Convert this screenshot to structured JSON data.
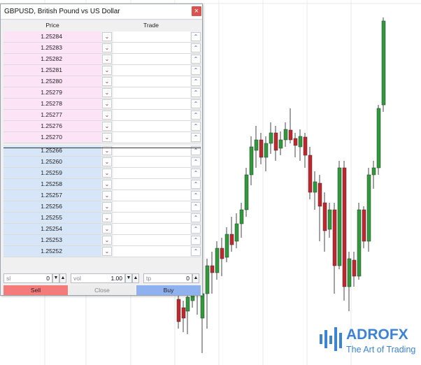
{
  "window": {
    "title": "GBPUSD, British Pound vs US Dollar",
    "close_glyph": "×"
  },
  "columns": {
    "price": "Price",
    "trade": "Trade"
  },
  "ask_prices": [
    "1.25284",
    "1.25283",
    "1.25282",
    "1.25281",
    "1.25280",
    "1.25279",
    "1.25278",
    "1.25277",
    "1.25276",
    "1.25270"
  ],
  "bid_prices": [
    "1.25266",
    "1.25260",
    "1.25259",
    "1.25258",
    "1.25257",
    "1.25256",
    "1.25255",
    "1.25254",
    "1.25253",
    "1.25252"
  ],
  "order": {
    "sl": {
      "placeholder": "sl",
      "value": "0"
    },
    "vol": {
      "placeholder": "vol",
      "value": "1.00"
    },
    "tp": {
      "placeholder": "tp",
      "value": "0"
    }
  },
  "actions": {
    "sell": "Sell",
    "close": "Close",
    "buy": "Buy"
  },
  "brand": {
    "name": "ADROFX",
    "tagline": "The Art of Trading"
  },
  "colors": {
    "ask_bg": "#fde3f6",
    "bid_bg": "#d6e5f8",
    "sell": "#f57a7a",
    "buy": "#8fb1f0",
    "bull": "#2e9a3a",
    "bear": "#c0262c",
    "brand": "#3c83d6"
  },
  "icons": {
    "sell_arrow": "chevron-down-icon",
    "buy_arrow": "chevron-up-icon"
  }
}
